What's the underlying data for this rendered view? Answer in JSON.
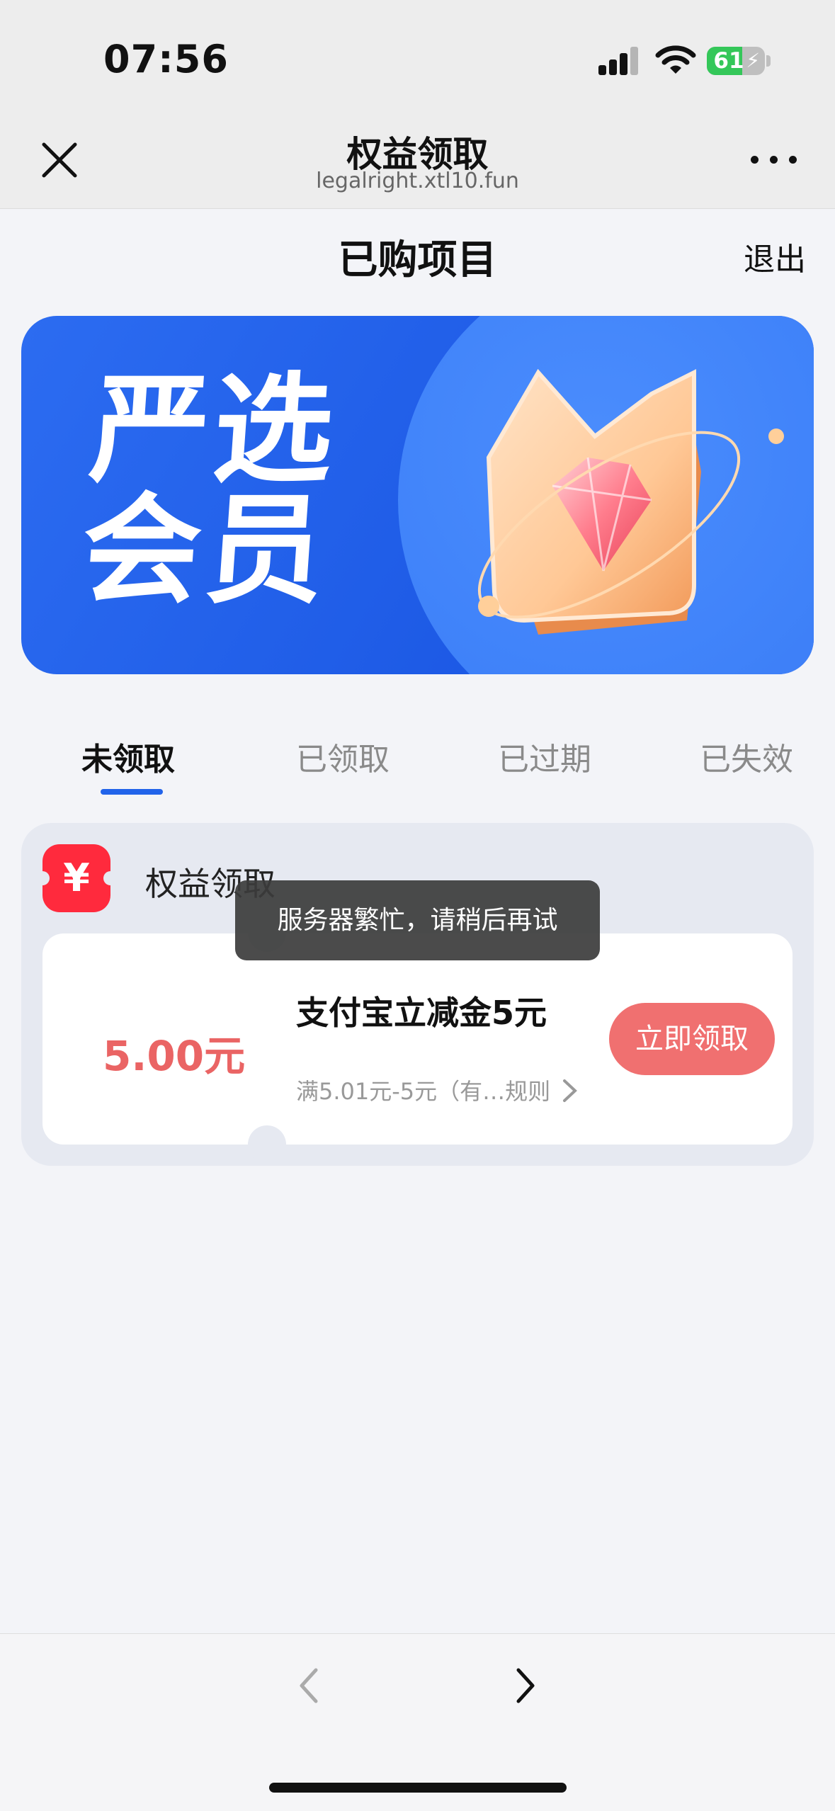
{
  "status_bar": {
    "time": "07:56",
    "battery": "61"
  },
  "browser": {
    "title": "权益领取",
    "url": "legalright.xtl10.fun"
  },
  "page": {
    "title": "已购项目",
    "logout": "退出"
  },
  "banner": {
    "line1": "严选",
    "line2": "会员"
  },
  "tabs": [
    {
      "label": "未领取",
      "active": true
    },
    {
      "label": "已领取",
      "active": false
    },
    {
      "label": "已过期",
      "active": false
    },
    {
      "label": "已失效",
      "active": false
    }
  ],
  "group": {
    "icon_symbol": "¥",
    "title": "权益领取"
  },
  "voucher": {
    "amount": "5.00元",
    "title": "支付宝立减金5元",
    "rule": "满5.01元-5元（有…规则",
    "claim_label": "立即领取"
  },
  "toast": "服务器繁忙，请稍后再试",
  "colors": {
    "accent_blue": "#2163ea",
    "voucher_red": "#ea6464",
    "button_red": "#f07070",
    "brand_red": "#ff2a3d"
  }
}
